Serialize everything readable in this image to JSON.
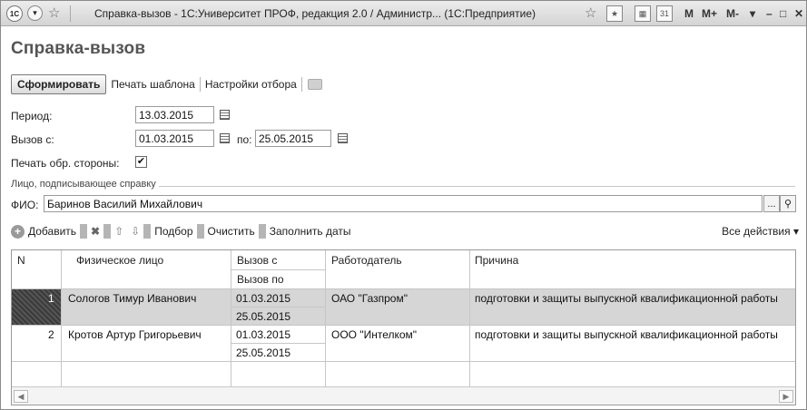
{
  "window": {
    "title": "Справка-вызов - 1С:Университет ПРОФ, редакция 2.0 / Администр... (1С:Предприятие)",
    "logo": "1С",
    "buttons": {
      "m": "M",
      "mplus": "M+",
      "mminus": "M-"
    }
  },
  "form": {
    "title": "Справка-вызов"
  },
  "toolbar": {
    "generate": "Сформировать",
    "print_template": "Печать шаблона",
    "filter_settings": "Настройки отбора"
  },
  "fields": {
    "period_label": "Период:",
    "period_value": "13.03.2015",
    "call_from_label": "Вызов с:",
    "call_from_value": "01.03.2015",
    "to_label": "по:",
    "to_value": "25.05.2015",
    "print_back_label": "Печать обр. стороны:",
    "print_back_checked": "✔"
  },
  "signer": {
    "group_label": "Лицо, подписывающее справку",
    "fio_label": "ФИО:",
    "fio_value": "Баринов Василий Михайлович",
    "select_btn": "...",
    "search_icon": "search-icon"
  },
  "table_toolbar": {
    "add": "Добавить",
    "pick": "Подбор",
    "clear": "Очистить",
    "fill_dates": "Заполнить даты",
    "all_actions": "Все действия ▾"
  },
  "table": {
    "headers": {
      "n": "N",
      "person": "Физическое лицо",
      "call_from": "Вызов с",
      "call_to": "Вызов по",
      "employer": "Работодатель",
      "reason": "Причина"
    },
    "rows": [
      {
        "n": "1",
        "person": "Сологов Тимур Иванович",
        "from": "01.03.2015",
        "to": "25.05.2015",
        "employer": "ОАО \"Газпром\"",
        "reason": "подготовки и защиты выпускной квалификационной работы"
      },
      {
        "n": "2",
        "person": "Кротов Артур Григорьевич",
        "from": "01.03.2015",
        "to": "25.05.2015",
        "employer": "ООО \"Интелком\"",
        "reason": "подготовки и защиты выпускной квалификационной работы"
      }
    ]
  }
}
